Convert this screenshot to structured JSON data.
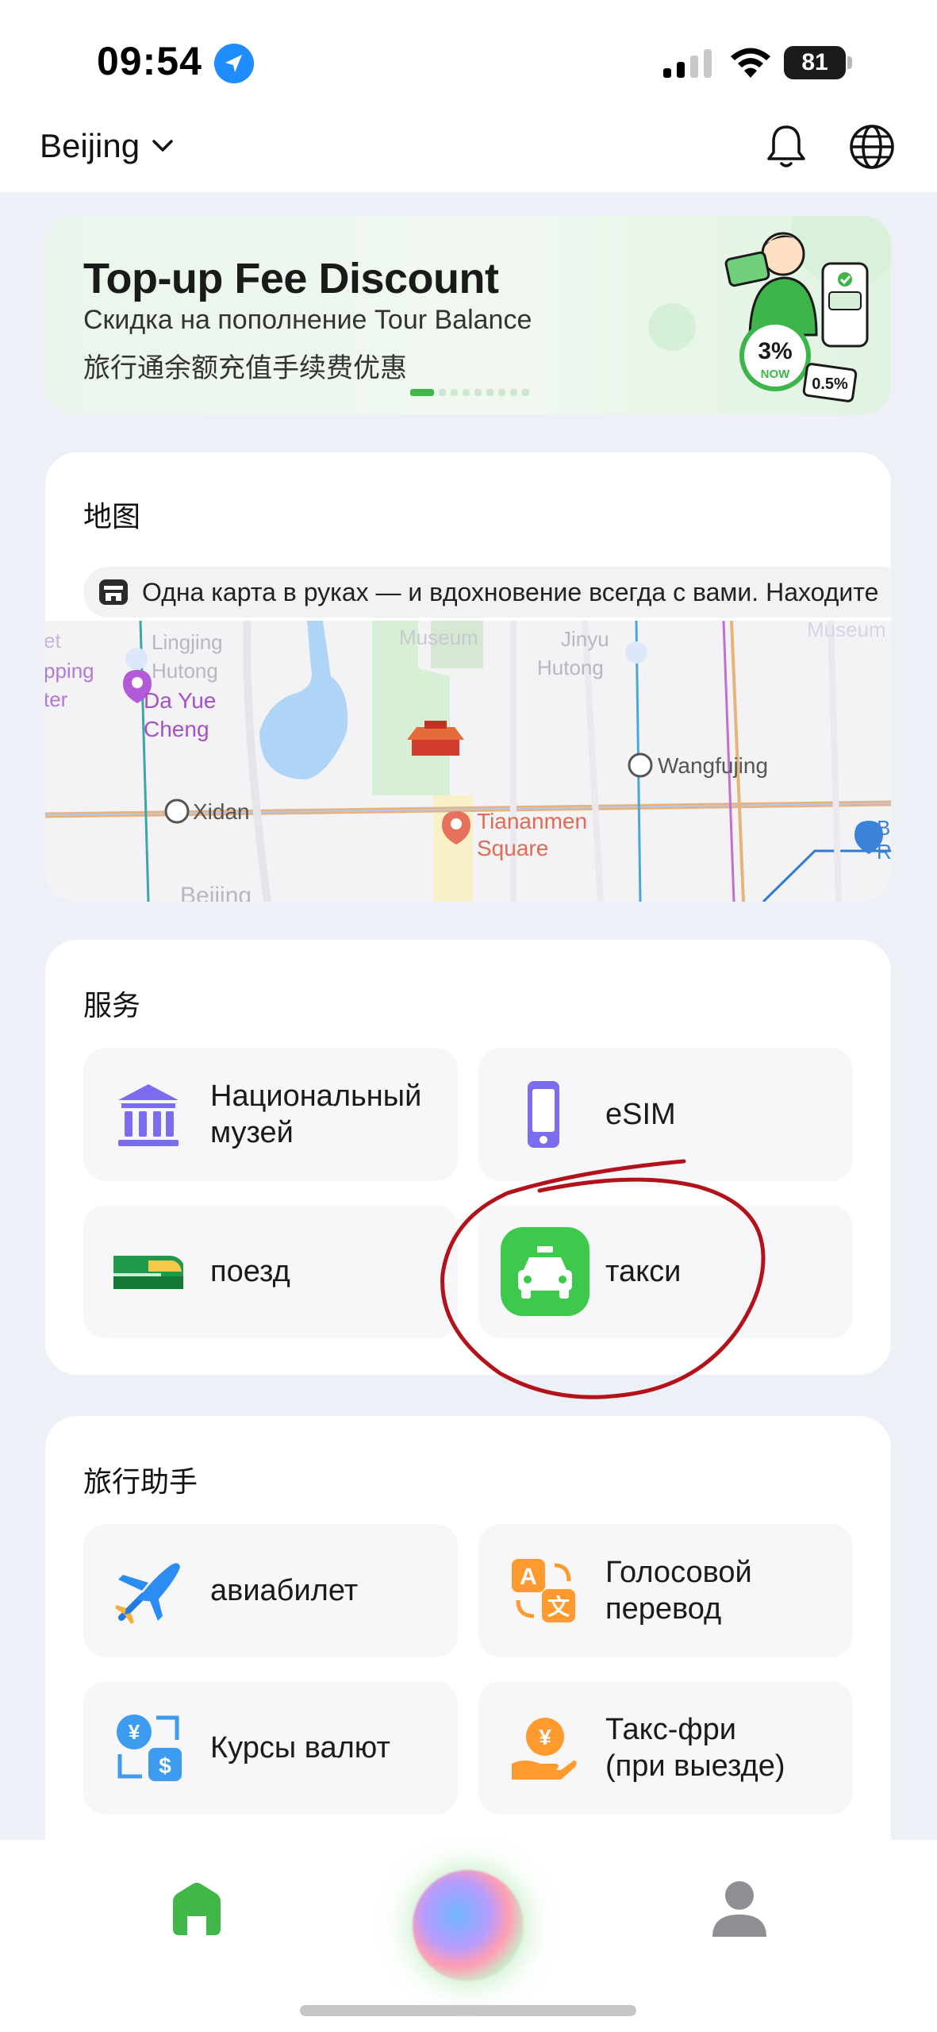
{
  "status_bar": {
    "time": "09:54",
    "battery": "81"
  },
  "header": {
    "city": "Beijing"
  },
  "banner": {
    "title": "Top-up Fee Discount",
    "subtitle_ru": "Скидка на пополнение Tour Balance",
    "subtitle_zh": "旅行通余额充值手续费优惠",
    "badge_main": "3%",
    "badge_now": "NOW",
    "badge_old": "0.5%"
  },
  "map": {
    "title": "地图",
    "ticker": "Одна карта в руках — и вдохновение всегда с вами. Находите",
    "labels": {
      "lingjing": "Lingjing",
      "hutong1": "Hutong",
      "museum1": "Museum",
      "jinyu": "Jinyu",
      "hutong2": "Hutong",
      "museum2": "Museum",
      "et": "et",
      "pping": "pping",
      "ter": "ter",
      "dayue": "Da Yue",
      "cheng": "Cheng",
      "wangfujing": "Wangfujing",
      "xidan": "Xidan",
      "tiananmen": "Tiananmen",
      "square": "Square",
      "beijing": "Beijing",
      "b": "B",
      "r": "R"
    }
  },
  "services": {
    "title": "服务",
    "items": [
      {
        "label": "Национальный\nмузей",
        "icon": "museum-icon"
      },
      {
        "label": "eSIM",
        "icon": "phone-icon"
      },
      {
        "label": "поезд",
        "icon": "train-icon"
      },
      {
        "label": "такси",
        "icon": "taxi-icon"
      }
    ]
  },
  "helper": {
    "title": "旅行助手",
    "items": [
      {
        "label": "авиабилет",
        "icon": "airplane-icon"
      },
      {
        "label": "Голосовой\nперевод",
        "icon": "translate-icon"
      },
      {
        "label": "Курсы валют",
        "icon": "currency-icon"
      },
      {
        "label": "Такс-фри\n(при выезде)",
        "icon": "tax-free-icon"
      }
    ]
  },
  "colors": {
    "brand_green": "#41b649",
    "annotation_red": "#b3121a",
    "page_bg": "#eef0f7"
  }
}
